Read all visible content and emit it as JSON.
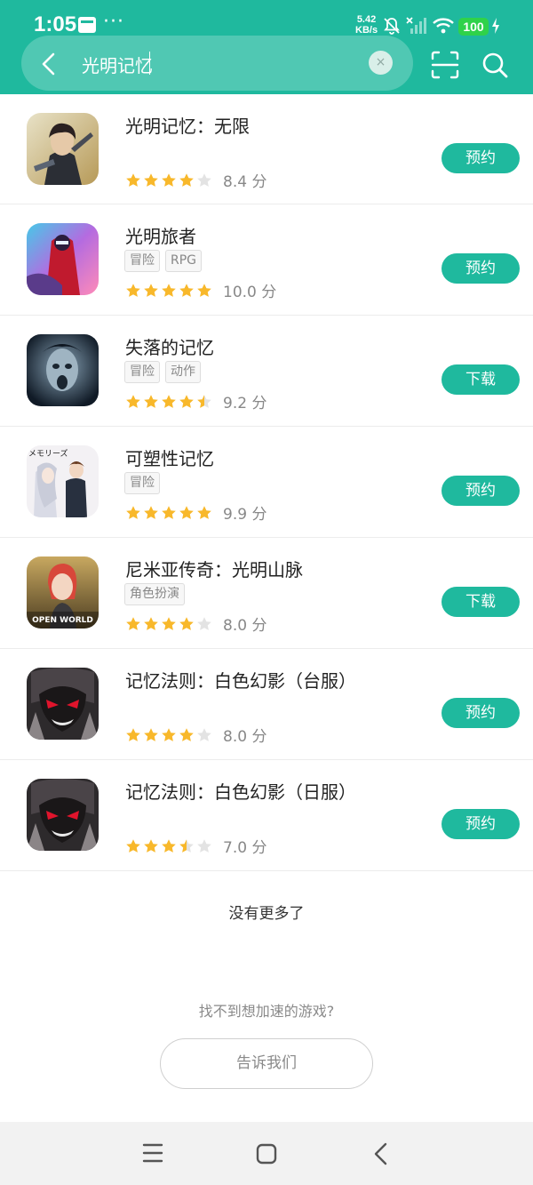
{
  "status": {
    "time": "1:05",
    "more": "···",
    "speed_value": "5.42",
    "speed_unit": "KB/s",
    "battery": "100"
  },
  "search": {
    "query": "光明记忆",
    "clear": "×"
  },
  "games": [
    {
      "title": "光明记忆：无限",
      "tags": [],
      "stars": 4,
      "score": "8.4 分",
      "action": "预约"
    },
    {
      "title": "光明旅者",
      "tags": [
        "冒险",
        "RPG"
      ],
      "stars": 5,
      "score": "10.0 分",
      "action": "预约"
    },
    {
      "title": "失落的记忆",
      "tags": [
        "冒险",
        "动作"
      ],
      "stars": 4.5,
      "score": "9.2 分",
      "action": "下载"
    },
    {
      "title": "可塑性记忆",
      "tags": [
        "冒险"
      ],
      "stars": 5,
      "score": "9.9 分",
      "action": "预约"
    },
    {
      "title": "尼米亚传奇：光明山脉",
      "tags": [
        "角色扮演"
      ],
      "stars": 4,
      "score": "8.0 分",
      "action": "下载"
    },
    {
      "title": "记忆法则：白色幻影（台服）",
      "tags": [],
      "stars": 4,
      "score": "8.0 分",
      "action": "预约"
    },
    {
      "title": "记忆法则：白色幻影（日服）",
      "tags": [],
      "stars": 3.5,
      "score": "7.0 分",
      "action": "预约"
    }
  ],
  "thumb_text": {
    "game4": "メモリーズ",
    "game5": "OPEN WORLD"
  },
  "footer": {
    "no_more": "没有更多了",
    "cant_find": "找不到想加速的游戏?",
    "tell_us": "告诉我们"
  },
  "colors": {
    "accent": "#1fb99e",
    "star": "#f8b82b",
    "star_empty": "#e3e3e3"
  }
}
